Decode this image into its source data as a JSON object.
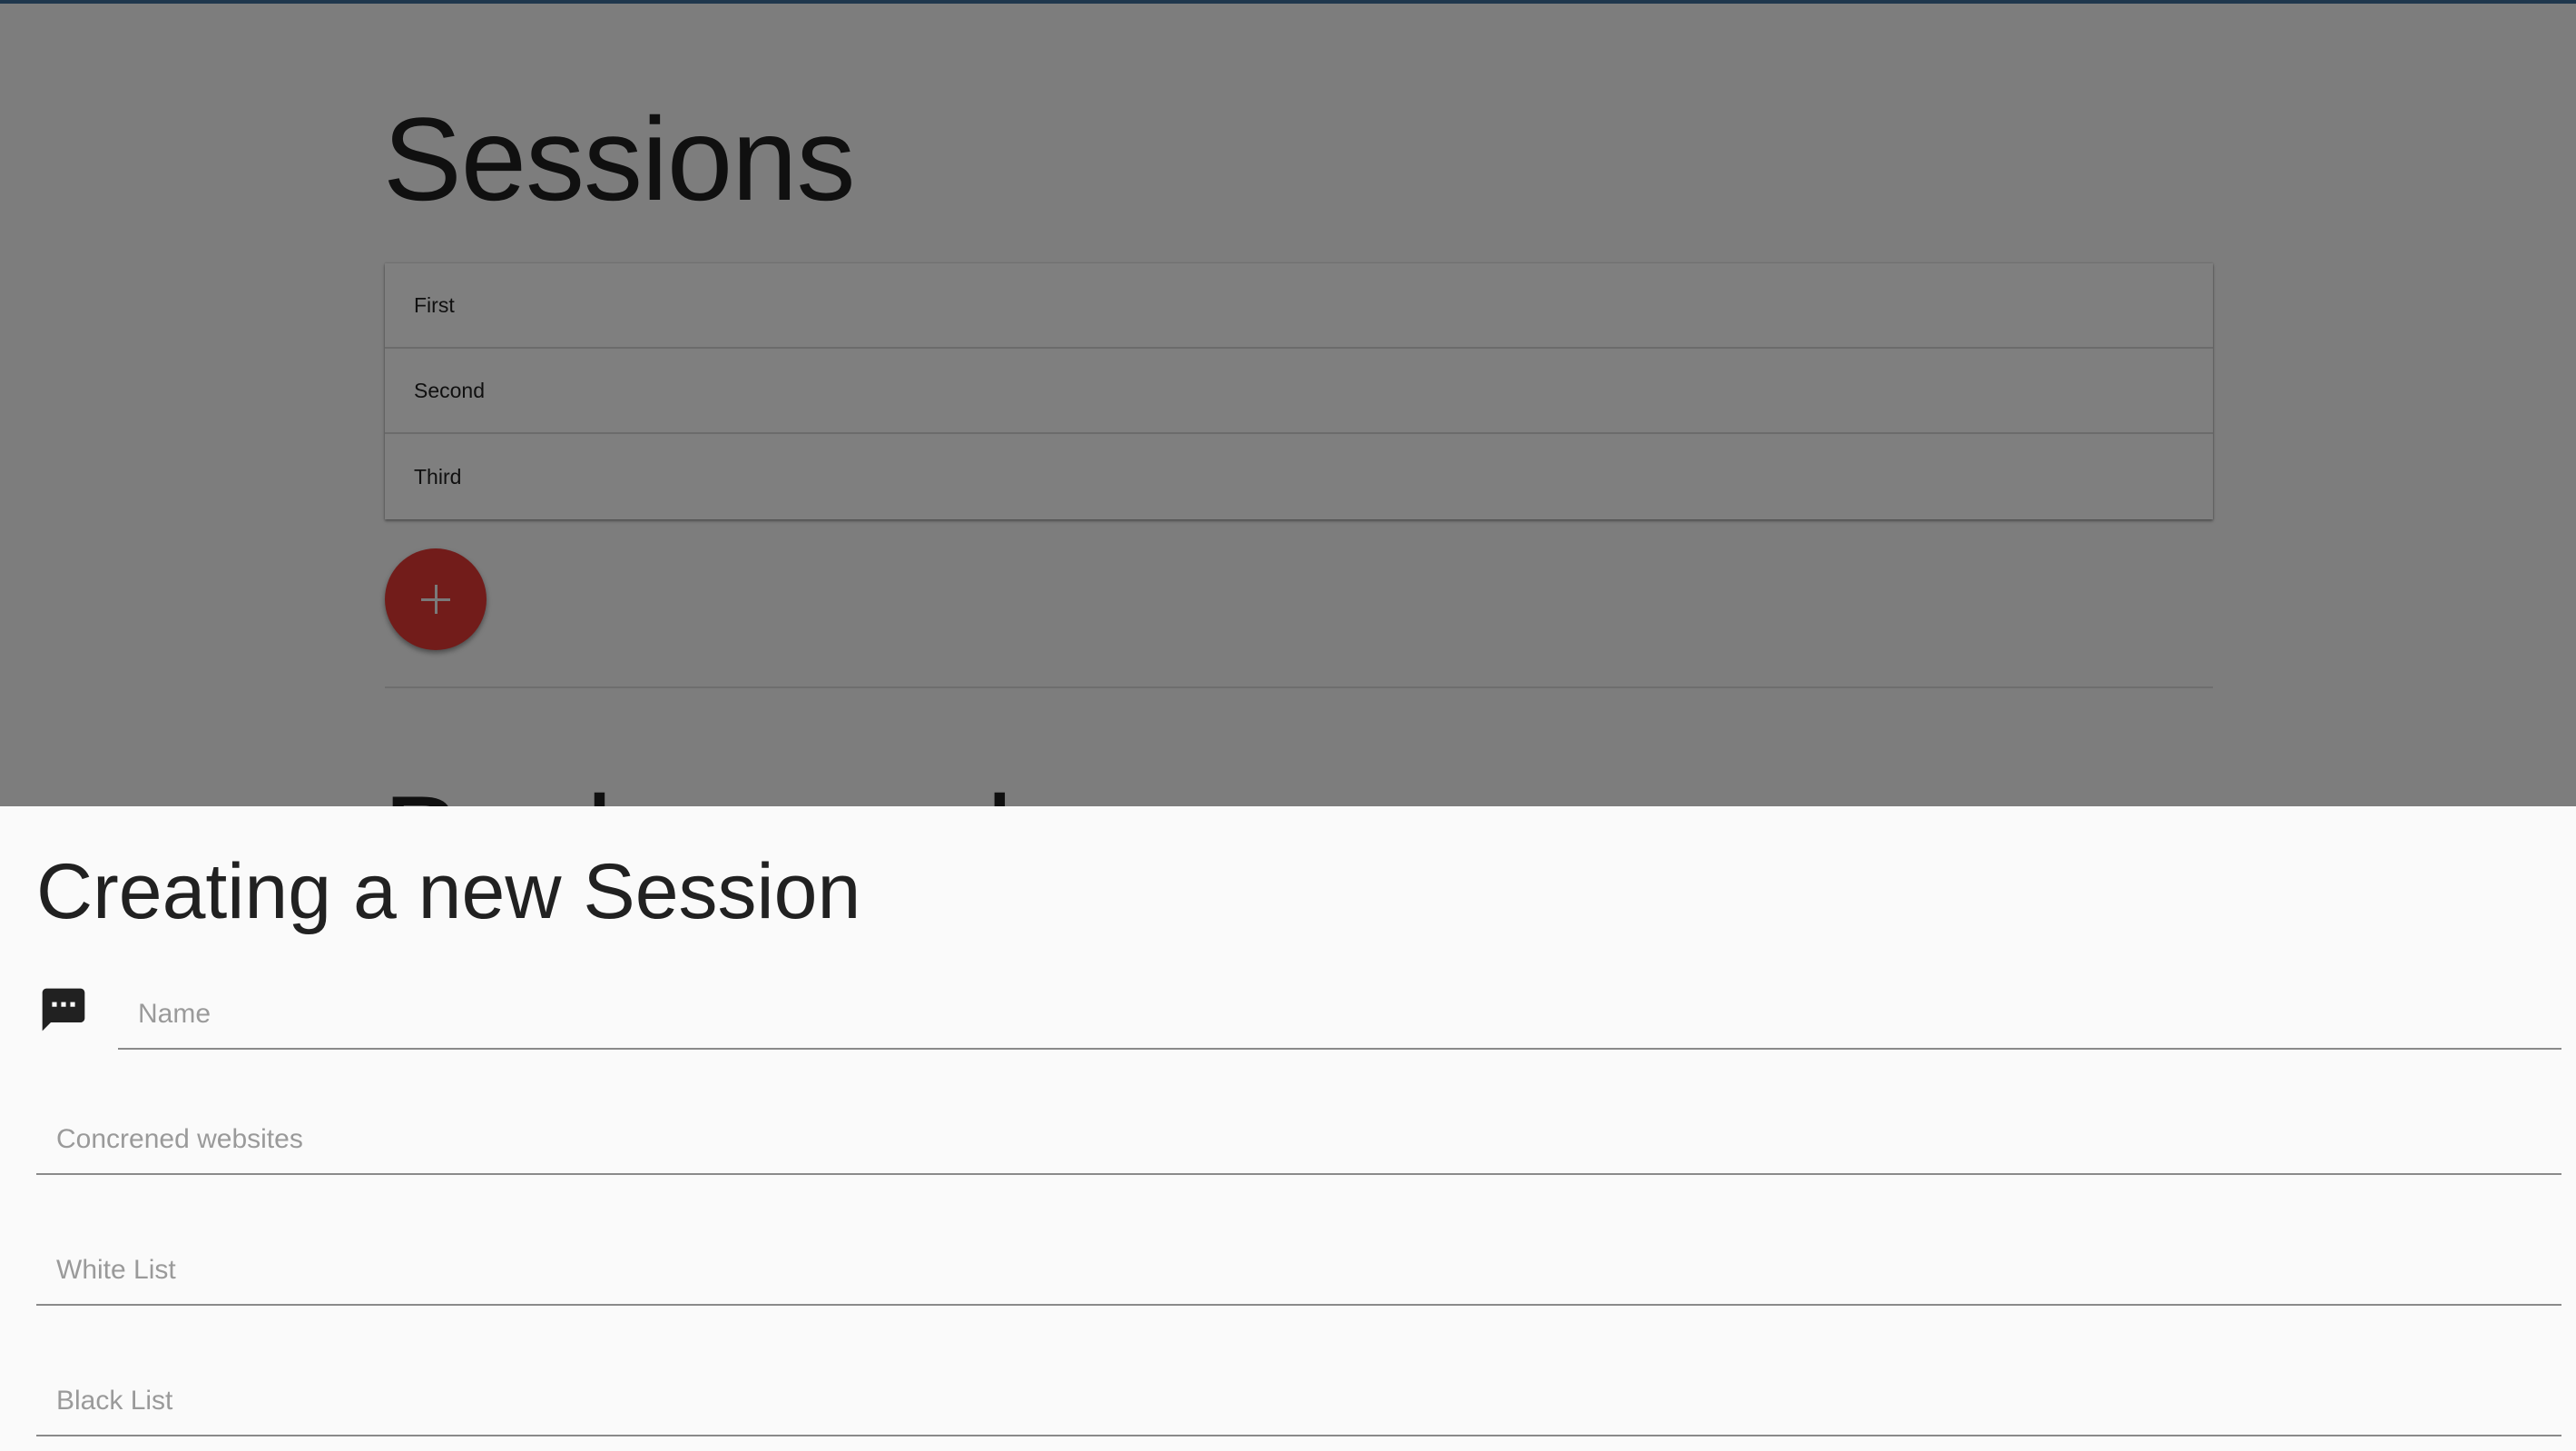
{
  "page": {
    "title": "Sessions",
    "sessions": [
      {
        "label": "First"
      },
      {
        "label": "Second"
      },
      {
        "label": "Third"
      }
    ],
    "add_button_icon": "plus-icon",
    "section_title": "Background"
  },
  "sheet": {
    "title": "Creating a new Session",
    "name_icon": "chat-bubble-icon",
    "fields": {
      "name": {
        "placeholder": "Name",
        "value": ""
      },
      "websites": {
        "placeholder": "Concrened websites",
        "value": ""
      },
      "white_list": {
        "placeholder": "White List",
        "value": ""
      },
      "black_list": {
        "placeholder": "Black List",
        "value": ""
      }
    }
  },
  "colors": {
    "accent": "#e53935",
    "topbar": "#3f6f9a",
    "scrim": "rgba(0,0,0,0.5)"
  }
}
